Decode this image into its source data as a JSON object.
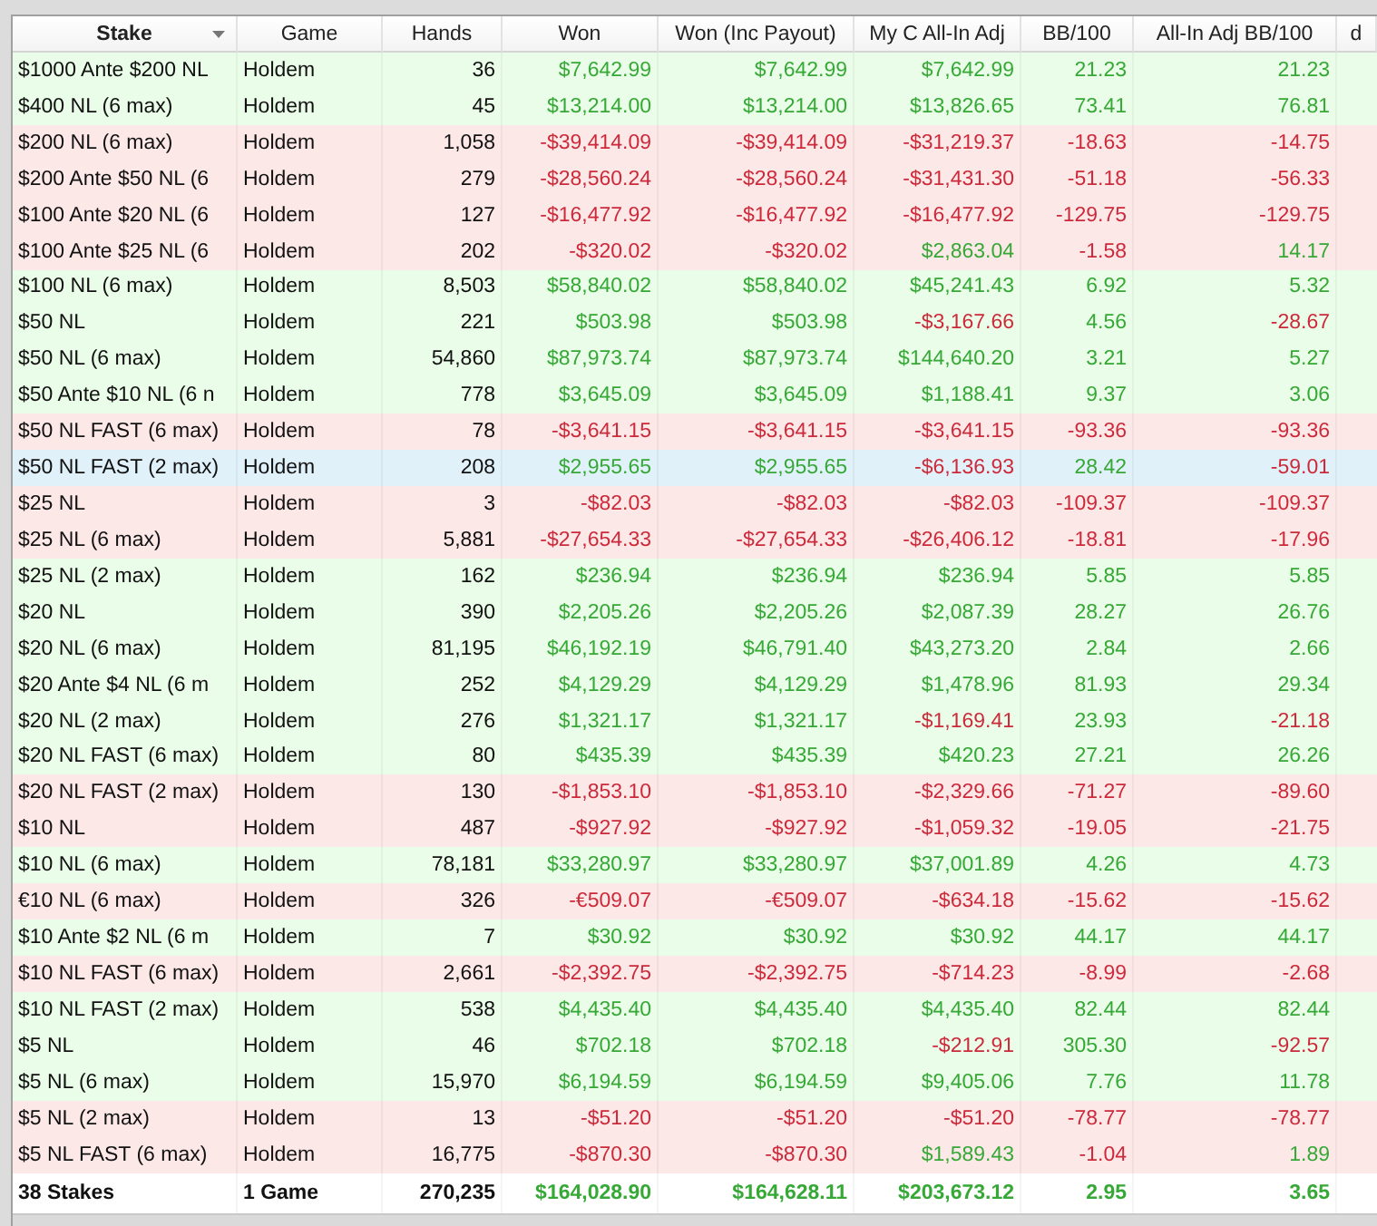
{
  "columns": [
    {
      "label": "Stake",
      "bold": true,
      "sorted": true
    },
    {
      "label": "Game",
      "bold": false,
      "sorted": false
    },
    {
      "label": "Hands",
      "bold": false,
      "sorted": false
    },
    {
      "label": "Won",
      "bold": false,
      "sorted": false
    },
    {
      "label": "Won (Inc Payout)",
      "bold": false,
      "sorted": false
    },
    {
      "label": "My C All-In Adj",
      "bold": false,
      "sorted": false
    },
    {
      "label": "BB/100",
      "bold": false,
      "sorted": false
    },
    {
      "label": "All-In Adj BB/100",
      "bold": false,
      "sorted": false
    },
    {
      "label": "d",
      "bold": false,
      "sorted": false
    }
  ],
  "rows": [
    {
      "stake": "$1000 Ante $200 NL",
      "game": "Holdem",
      "hands": "36",
      "loss": false,
      "selected": false,
      "figures": [
        {
          "text": "$7,642.99",
          "loss": false
        },
        {
          "text": "$7,642.99",
          "loss": false
        },
        {
          "text": "$7,642.99",
          "loss": false
        },
        {
          "text": "21.23",
          "loss": false
        },
        {
          "text": "21.23",
          "loss": false
        }
      ]
    },
    {
      "stake": "$400 NL (6 max)",
      "game": "Holdem",
      "hands": "45",
      "loss": false,
      "selected": false,
      "figures": [
        {
          "text": "$13,214.00",
          "loss": false
        },
        {
          "text": "$13,214.00",
          "loss": false
        },
        {
          "text": "$13,826.65",
          "loss": false
        },
        {
          "text": "73.41",
          "loss": false
        },
        {
          "text": "76.81",
          "loss": false
        }
      ]
    },
    {
      "stake": "$200 NL (6 max)",
      "game": "Holdem",
      "hands": "1,058",
      "loss": true,
      "selected": false,
      "figures": [
        {
          "text": "-$39,414.09",
          "loss": true
        },
        {
          "text": "-$39,414.09",
          "loss": true
        },
        {
          "text": "-$31,219.37",
          "loss": true
        },
        {
          "text": "-18.63",
          "loss": true
        },
        {
          "text": "-14.75",
          "loss": true
        }
      ]
    },
    {
      "stake": "$200 Ante $50 NL (6",
      "game": "Holdem",
      "hands": "279",
      "loss": true,
      "selected": false,
      "figures": [
        {
          "text": "-$28,560.24",
          "loss": true
        },
        {
          "text": "-$28,560.24",
          "loss": true
        },
        {
          "text": "-$31,431.30",
          "loss": true
        },
        {
          "text": "-51.18",
          "loss": true
        },
        {
          "text": "-56.33",
          "loss": true
        }
      ]
    },
    {
      "stake": "$100 Ante $20 NL (6",
      "game": "Holdem",
      "hands": "127",
      "loss": true,
      "selected": false,
      "figures": [
        {
          "text": "-$16,477.92",
          "loss": true
        },
        {
          "text": "-$16,477.92",
          "loss": true
        },
        {
          "text": "-$16,477.92",
          "loss": true
        },
        {
          "text": "-129.75",
          "loss": true
        },
        {
          "text": "-129.75",
          "loss": true
        }
      ]
    },
    {
      "stake": "$100 Ante $25 NL (6",
      "game": "Holdem",
      "hands": "202",
      "loss": true,
      "selected": false,
      "figures": [
        {
          "text": "-$320.02",
          "loss": true
        },
        {
          "text": "-$320.02",
          "loss": true
        },
        {
          "text": "$2,863.04",
          "loss": false
        },
        {
          "text": "-1.58",
          "loss": true
        },
        {
          "text": "14.17",
          "loss": false
        }
      ]
    },
    {
      "stake": "$100 NL (6 max)",
      "game": "Holdem",
      "hands": "8,503",
      "loss": false,
      "selected": false,
      "figures": [
        {
          "text": "$58,840.02",
          "loss": false
        },
        {
          "text": "$58,840.02",
          "loss": false
        },
        {
          "text": "$45,241.43",
          "loss": false
        },
        {
          "text": "6.92",
          "loss": false
        },
        {
          "text": "5.32",
          "loss": false
        }
      ]
    },
    {
      "stake": "$50 NL",
      "game": "Holdem",
      "hands": "221",
      "loss": false,
      "selected": false,
      "figures": [
        {
          "text": "$503.98",
          "loss": false
        },
        {
          "text": "$503.98",
          "loss": false
        },
        {
          "text": "-$3,167.66",
          "loss": true
        },
        {
          "text": "4.56",
          "loss": false
        },
        {
          "text": "-28.67",
          "loss": true
        }
      ]
    },
    {
      "stake": "$50 NL (6 max)",
      "game": "Holdem",
      "hands": "54,860",
      "loss": false,
      "selected": false,
      "figures": [
        {
          "text": "$87,973.74",
          "loss": false
        },
        {
          "text": "$87,973.74",
          "loss": false
        },
        {
          "text": "$144,640.20",
          "loss": false
        },
        {
          "text": "3.21",
          "loss": false
        },
        {
          "text": "5.27",
          "loss": false
        }
      ]
    },
    {
      "stake": "$50 Ante $10 NL (6 n",
      "game": "Holdem",
      "hands": "778",
      "loss": false,
      "selected": false,
      "figures": [
        {
          "text": "$3,645.09",
          "loss": false
        },
        {
          "text": "$3,645.09",
          "loss": false
        },
        {
          "text": "$1,188.41",
          "loss": false
        },
        {
          "text": "9.37",
          "loss": false
        },
        {
          "text": "3.06",
          "loss": false
        }
      ]
    },
    {
      "stake": "$50 NL FAST (6 max)",
      "game": "Holdem",
      "hands": "78",
      "loss": true,
      "selected": false,
      "figures": [
        {
          "text": "-$3,641.15",
          "loss": true
        },
        {
          "text": "-$3,641.15",
          "loss": true
        },
        {
          "text": "-$3,641.15",
          "loss": true
        },
        {
          "text": "-93.36",
          "loss": true
        },
        {
          "text": "-93.36",
          "loss": true
        }
      ]
    },
    {
      "stake": "$50 NL FAST (2 max)",
      "game": "Holdem",
      "hands": "208",
      "selected": true,
      "figures": [
        {
          "text": "$2,955.65",
          "loss": false
        },
        {
          "text": "$2,955.65",
          "loss": false
        },
        {
          "text": "-$6,136.93",
          "loss": true
        },
        {
          "text": "28.42",
          "loss": false
        },
        {
          "text": "-59.01",
          "loss": true
        }
      ]
    },
    {
      "stake": "$25 NL",
      "game": "Holdem",
      "hands": "3",
      "loss": true,
      "selected": false,
      "figures": [
        {
          "text": "-$82.03",
          "loss": true
        },
        {
          "text": "-$82.03",
          "loss": true
        },
        {
          "text": "-$82.03",
          "loss": true
        },
        {
          "text": "-109.37",
          "loss": true
        },
        {
          "text": "-109.37",
          "loss": true
        }
      ]
    },
    {
      "stake": "$25 NL (6 max)",
      "game": "Holdem",
      "hands": "5,881",
      "loss": true,
      "selected": false,
      "figures": [
        {
          "text": "-$27,654.33",
          "loss": true
        },
        {
          "text": "-$27,654.33",
          "loss": true
        },
        {
          "text": "-$26,406.12",
          "loss": true
        },
        {
          "text": "-18.81",
          "loss": true
        },
        {
          "text": "-17.96",
          "loss": true
        }
      ]
    },
    {
      "stake": "$25 NL (2 max)",
      "game": "Holdem",
      "hands": "162",
      "loss": false,
      "selected": false,
      "figures": [
        {
          "text": "$236.94",
          "loss": false
        },
        {
          "text": "$236.94",
          "loss": false
        },
        {
          "text": "$236.94",
          "loss": false
        },
        {
          "text": "5.85",
          "loss": false
        },
        {
          "text": "5.85",
          "loss": false
        }
      ]
    },
    {
      "stake": "$20 NL",
      "game": "Holdem",
      "hands": "390",
      "loss": false,
      "selected": false,
      "figures": [
        {
          "text": "$2,205.26",
          "loss": false
        },
        {
          "text": "$2,205.26",
          "loss": false
        },
        {
          "text": "$2,087.39",
          "loss": false
        },
        {
          "text": "28.27",
          "loss": false
        },
        {
          "text": "26.76",
          "loss": false
        }
      ]
    },
    {
      "stake": "$20 NL (6 max)",
      "game": "Holdem",
      "hands": "81,195",
      "loss": false,
      "selected": false,
      "figures": [
        {
          "text": "$46,192.19",
          "loss": false
        },
        {
          "text": "$46,791.40",
          "loss": false
        },
        {
          "text": "$43,273.20",
          "loss": false
        },
        {
          "text": "2.84",
          "loss": false
        },
        {
          "text": "2.66",
          "loss": false
        }
      ]
    },
    {
      "stake": "$20 Ante $4 NL (6 m",
      "game": "Holdem",
      "hands": "252",
      "loss": false,
      "selected": false,
      "figures": [
        {
          "text": "$4,129.29",
          "loss": false
        },
        {
          "text": "$4,129.29",
          "loss": false
        },
        {
          "text": "$1,478.96",
          "loss": false
        },
        {
          "text": "81.93",
          "loss": false
        },
        {
          "text": "29.34",
          "loss": false
        }
      ]
    },
    {
      "stake": "$20 NL (2 max)",
      "game": "Holdem",
      "hands": "276",
      "loss": false,
      "selected": false,
      "figures": [
        {
          "text": "$1,321.17",
          "loss": false
        },
        {
          "text": "$1,321.17",
          "loss": false
        },
        {
          "text": "-$1,169.41",
          "loss": true
        },
        {
          "text": "23.93",
          "loss": false
        },
        {
          "text": "-21.18",
          "loss": true
        }
      ]
    },
    {
      "stake": "$20 NL FAST (6 max)",
      "game": "Holdem",
      "hands": "80",
      "loss": false,
      "selected": false,
      "figures": [
        {
          "text": "$435.39",
          "loss": false
        },
        {
          "text": "$435.39",
          "loss": false
        },
        {
          "text": "$420.23",
          "loss": false
        },
        {
          "text": "27.21",
          "loss": false
        },
        {
          "text": "26.26",
          "loss": false
        }
      ]
    },
    {
      "stake": "$20 NL FAST (2 max)",
      "game": "Holdem",
      "hands": "130",
      "loss": true,
      "selected": false,
      "figures": [
        {
          "text": "-$1,853.10",
          "loss": true
        },
        {
          "text": "-$1,853.10",
          "loss": true
        },
        {
          "text": "-$2,329.66",
          "loss": true
        },
        {
          "text": "-71.27",
          "loss": true
        },
        {
          "text": "-89.60",
          "loss": true
        }
      ]
    },
    {
      "stake": "$10 NL",
      "game": "Holdem",
      "hands": "487",
      "loss": true,
      "selected": false,
      "figures": [
        {
          "text": "-$927.92",
          "loss": true
        },
        {
          "text": "-$927.92",
          "loss": true
        },
        {
          "text": "-$1,059.32",
          "loss": true
        },
        {
          "text": "-19.05",
          "loss": true
        },
        {
          "text": "-21.75",
          "loss": true
        }
      ]
    },
    {
      "stake": "$10 NL (6 max)",
      "game": "Holdem",
      "hands": "78,181",
      "loss": false,
      "selected": false,
      "figures": [
        {
          "text": "$33,280.97",
          "loss": false
        },
        {
          "text": "$33,280.97",
          "loss": false
        },
        {
          "text": "$37,001.89",
          "loss": false
        },
        {
          "text": "4.26",
          "loss": false
        },
        {
          "text": "4.73",
          "loss": false
        }
      ]
    },
    {
      "stake": "€10 NL (6 max)",
      "game": "Holdem",
      "hands": "326",
      "loss": true,
      "selected": false,
      "figures": [
        {
          "text": "-€509.07",
          "loss": true
        },
        {
          "text": "-€509.07",
          "loss": true
        },
        {
          "text": "-$634.18",
          "loss": true
        },
        {
          "text": "-15.62",
          "loss": true
        },
        {
          "text": "-15.62",
          "loss": true
        }
      ]
    },
    {
      "stake": "$10 Ante $2 NL (6 m",
      "game": "Holdem",
      "hands": "7",
      "loss": false,
      "selected": false,
      "figures": [
        {
          "text": "$30.92",
          "loss": false
        },
        {
          "text": "$30.92",
          "loss": false
        },
        {
          "text": "$30.92",
          "loss": false
        },
        {
          "text": "44.17",
          "loss": false
        },
        {
          "text": "44.17",
          "loss": false
        }
      ]
    },
    {
      "stake": "$10 NL FAST (6 max)",
      "game": "Holdem",
      "hands": "2,661",
      "loss": true,
      "selected": false,
      "figures": [
        {
          "text": "-$2,392.75",
          "loss": true
        },
        {
          "text": "-$2,392.75",
          "loss": true
        },
        {
          "text": "-$714.23",
          "loss": true
        },
        {
          "text": "-8.99",
          "loss": true
        },
        {
          "text": "-2.68",
          "loss": true
        }
      ]
    },
    {
      "stake": "$10 NL FAST (2 max)",
      "game": "Holdem",
      "hands": "538",
      "loss": false,
      "selected": false,
      "figures": [
        {
          "text": "$4,435.40",
          "loss": false
        },
        {
          "text": "$4,435.40",
          "loss": false
        },
        {
          "text": "$4,435.40",
          "loss": false
        },
        {
          "text": "82.44",
          "loss": false
        },
        {
          "text": "82.44",
          "loss": false
        }
      ]
    },
    {
      "stake": "$5 NL",
      "game": "Holdem",
      "hands": "46",
      "loss": false,
      "selected": false,
      "figures": [
        {
          "text": "$702.18",
          "loss": false
        },
        {
          "text": "$702.18",
          "loss": false
        },
        {
          "text": "-$212.91",
          "loss": true
        },
        {
          "text": "305.30",
          "loss": false
        },
        {
          "text": "-92.57",
          "loss": true
        }
      ]
    },
    {
      "stake": "$5 NL (6 max)",
      "game": "Holdem",
      "hands": "15,970",
      "loss": false,
      "selected": false,
      "figures": [
        {
          "text": "$6,194.59",
          "loss": false
        },
        {
          "text": "$6,194.59",
          "loss": false
        },
        {
          "text": "$9,405.06",
          "loss": false
        },
        {
          "text": "7.76",
          "loss": false
        },
        {
          "text": "11.78",
          "loss": false
        }
      ]
    },
    {
      "stake": "$5 NL (2 max)",
      "game": "Holdem",
      "hands": "13",
      "loss": true,
      "selected": false,
      "figures": [
        {
          "text": "-$51.20",
          "loss": true
        },
        {
          "text": "-$51.20",
          "loss": true
        },
        {
          "text": "-$51.20",
          "loss": true
        },
        {
          "text": "-78.77",
          "loss": true
        },
        {
          "text": "-78.77",
          "loss": true
        }
      ]
    },
    {
      "stake": "$5 NL FAST (6 max)",
      "game": "Holdem",
      "hands": "16,775",
      "loss": true,
      "selected": false,
      "figures": [
        {
          "text": "-$870.30",
          "loss": true
        },
        {
          "text": "-$870.30",
          "loss": true
        },
        {
          "text": "$1,589.43",
          "loss": false
        },
        {
          "text": "-1.04",
          "loss": true
        },
        {
          "text": "1.89",
          "loss": false
        }
      ]
    }
  ],
  "totals": {
    "stake": "38 Stakes",
    "game": "1 Game",
    "hands": "270,235",
    "figures": [
      {
        "text": "$164,028.90",
        "loss": false
      },
      {
        "text": "$164,628.11",
        "loss": false
      },
      {
        "text": "$203,673.12",
        "loss": false
      },
      {
        "text": "2.95",
        "loss": false
      },
      {
        "text": "3.65",
        "loss": false
      }
    ]
  }
}
